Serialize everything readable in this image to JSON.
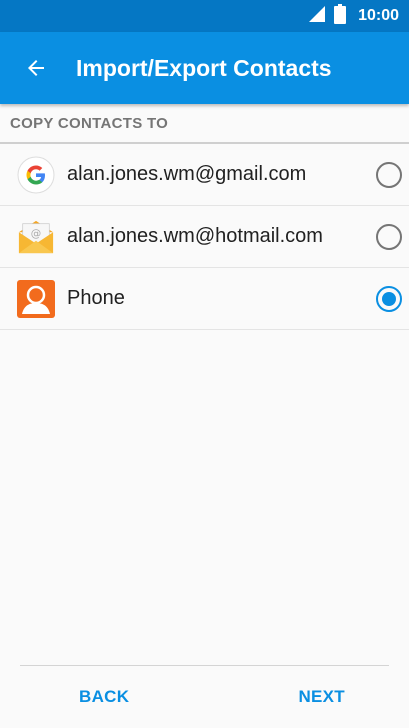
{
  "status_bar": {
    "time": "10:00",
    "icons": [
      "signal-icon",
      "battery-icon"
    ]
  },
  "app_bar": {
    "title": "Import/Export Contacts",
    "nav_icon": "back-arrow-icon"
  },
  "section": {
    "header": "COPY CONTACTS TO"
  },
  "items": [
    {
      "label": "alan.jones.wm@gmail.com",
      "icon": "google-icon",
      "selected": false
    },
    {
      "label": "alan.jones.wm@hotmail.com",
      "icon": "email-icon",
      "selected": false
    },
    {
      "label": "Phone",
      "icon": "phone-contact-icon",
      "selected": true
    }
  ],
  "footer": {
    "back_label": "BACK",
    "next_label": "NEXT"
  },
  "colors": {
    "status_bar": "#0577c4",
    "app_bar": "#0a8fe2",
    "accent": "#0a8fe2",
    "phone_icon": "#f26b1d"
  }
}
